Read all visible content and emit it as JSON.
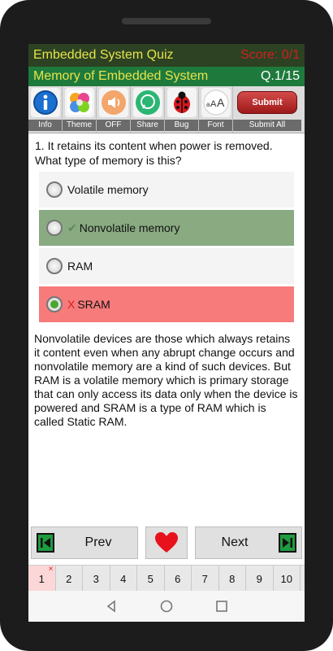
{
  "header": {
    "title": "Embedded System Quiz",
    "score": "Score: 0/1",
    "subtitle": "Memory of Embedded System",
    "question_number": "Q.1/15"
  },
  "toolbar": {
    "items": [
      {
        "label": "Info",
        "icon": "info-icon"
      },
      {
        "label": "Theme",
        "icon": "theme-icon"
      },
      {
        "label": "OFF",
        "icon": "sound-off-icon"
      },
      {
        "label": "Share",
        "icon": "share-icon"
      },
      {
        "label": "Bug",
        "icon": "bug-icon"
      },
      {
        "label": "Font",
        "icon": "font-icon"
      }
    ],
    "submit_button": "Submit",
    "submit_label": "Submit All"
  },
  "question": {
    "text": "1. It retains its content when power is removed. What type of memory is this?"
  },
  "options": [
    {
      "text": "Volatile memory",
      "state": "neutral",
      "mark": ""
    },
    {
      "text": "Nonvolatile memory",
      "state": "correct",
      "mark": "✔"
    },
    {
      "text": "RAM",
      "state": "neutral",
      "mark": ""
    },
    {
      "text": "SRAM",
      "state": "wrong",
      "mark": "X",
      "selected": true
    }
  ],
  "explanation": "Nonvolatile devices are those which always retains it content even when any abrupt change occurs and nonvolatile memory are a kind of such devices. But RAM is a volatile memory which is primary storage that can only access its data only when the device is powered and SRAM is a type of RAM which is called Static RAM.",
  "nav": {
    "prev": "Prev",
    "next": "Next"
  },
  "pages": {
    "numbers": [
      "1",
      "2",
      "3",
      "4",
      "5",
      "6",
      "7",
      "8",
      "9",
      "10"
    ],
    "current": "1",
    "wrong_marker": "×"
  },
  "colors": {
    "header_dark": "#2c4222",
    "header_green": "#1e7a3c",
    "title_yellow": "#e8e34a",
    "score_red": "#d02020",
    "correct_bg": "#8aab82",
    "wrong_bg": "#f77b7b",
    "submit_red": "#b32020"
  }
}
